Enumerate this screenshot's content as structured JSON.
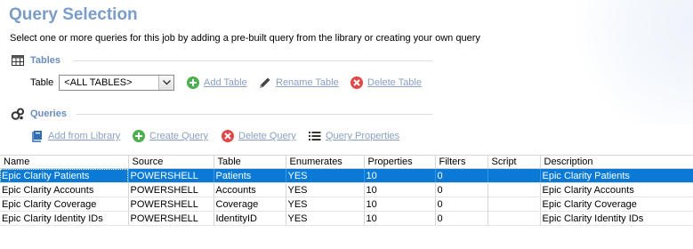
{
  "header": {
    "title": "Query Selection",
    "subtitle": "Select one or more queries for this job by adding a pre-built query from the library or creating your own query"
  },
  "tables_section": {
    "heading": "Tables",
    "table_label": "Table",
    "select_value": "<ALL TABLES>",
    "add_label": "Add Table",
    "rename_label": "Rename Table",
    "delete_label": "Delete Table"
  },
  "queries_section": {
    "heading": "Queries",
    "add_library_label": "Add from Library",
    "create_label": "Create Query",
    "delete_label": "Delete Query",
    "properties_label": "Query Properties"
  },
  "grid": {
    "columns": [
      "Name",
      "Source",
      "Table",
      "Enumerates",
      "Properties",
      "Filters",
      "Script",
      "Description"
    ],
    "rows": [
      [
        "Epic Clarity Patients",
        "POWERSHELL",
        "Patients",
        "YES",
        "10",
        "0",
        "",
        "Epic Clarity Patients"
      ],
      [
        "Epic Clarity Accounts",
        "POWERSHELL",
        "Accounts",
        "YES",
        "10",
        "0",
        "",
        "Epic Clarity Accounts"
      ],
      [
        "Epic Clarity Coverage",
        "POWERSHELL",
        "Coverage",
        "YES",
        "10",
        "0",
        "",
        "Epic Clarity Coverage"
      ],
      [
        "Epic Clarity Identity IDs",
        "POWERSHELL",
        "IdentityID",
        "YES",
        "10",
        "0",
        "",
        "Epic Clarity Identity IDs"
      ]
    ],
    "selected_row": 0
  },
  "colors": {
    "title": "#7a9cc9",
    "section_heading": "#6b8cbf",
    "link": "#8aa0c0",
    "selection": "#0a7ad6",
    "add_green": "#4caf50",
    "delete_red": "#e04848"
  },
  "icons": {
    "tables": "table-grid-icon",
    "queries": "queries-gears-icon",
    "add": "green-plus-circle-icon",
    "rename": "pencil-icon",
    "delete": "red-x-circle-icon",
    "library": "book-icon",
    "properties": "list-icon",
    "dropdown": "chevron-down-icon"
  }
}
